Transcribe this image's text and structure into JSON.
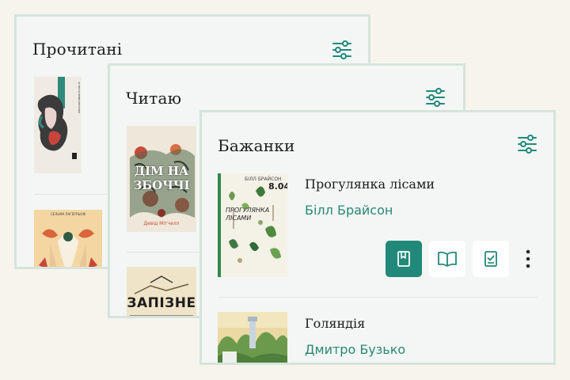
{
  "cards": {
    "read": {
      "title": "Прочитані",
      "book1_cover_text": "ЗА ПРОЗОРИМИ ВІКНАМИ",
      "book2_cover_text": "СЕЛЬМА ЛАГЕРЛЬОФ"
    },
    "reading": {
      "title": "Читаю",
      "book1_cover_title": "ДІМ НА ЗБОЧЧІ",
      "book1_cover_author": "Девід Мітчелл",
      "book2_cover_title": "ЗАПІЗНЕ"
    },
    "wishlist": {
      "title": "Бажанки",
      "books": [
        {
          "title": "Прогулянка лісами",
          "author": "Білл Брайсон",
          "cover_author": "БІЛЛ БРАЙСОН",
          "cover_title": "ПРОГУЛЯНКА ЛІСАМИ",
          "cover_number": "8.04"
        },
        {
          "title": "Голяндія",
          "author": "Дмитро Бузько"
        }
      ]
    }
  },
  "icons": {
    "filter": "sliders-icon",
    "want": "bookmark-icon",
    "reading": "open-book-icon",
    "done": "book-check-icon",
    "more": "more-vertical-icon"
  },
  "colors": {
    "accent": "#21897a",
    "author": "#2a8777",
    "card_bg": "#f3f6f4",
    "card_border": "#d5e4dc",
    "page_bg": "#f7f4ee"
  }
}
